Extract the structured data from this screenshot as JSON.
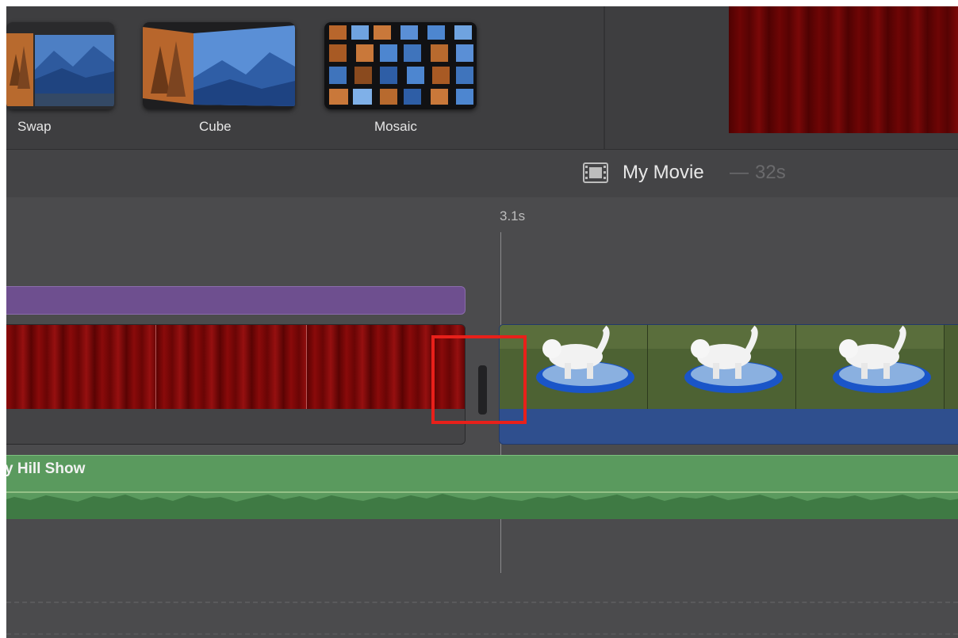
{
  "transitions": [
    {
      "label": "Swap",
      "icon": "swap-transition-thumbnail"
    },
    {
      "label": "Cube",
      "icon": "cube-transition-thumbnail"
    },
    {
      "label": "Mosaic",
      "icon": "mosaic-transition-thumbnail"
    }
  ],
  "project": {
    "title": "My Movie",
    "separator": "—",
    "duration": "32s",
    "icon": "film-strip-icon"
  },
  "timeline": {
    "playhead_time": "3.1s",
    "audio_clip_label": "y Hill Show"
  },
  "colors": {
    "title_track": "#6e4f8f",
    "audio_track": "#5a9a5e",
    "dog_clip_bar": "#2f4f8e",
    "highlight": "#e8201a"
  }
}
